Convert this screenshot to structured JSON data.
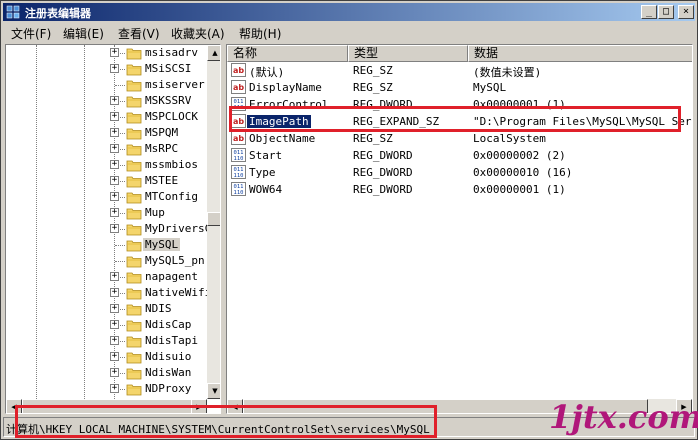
{
  "window": {
    "title": "注册表编辑器",
    "minimize_label": "_",
    "maximize_label": "□",
    "close_label": "×"
  },
  "menu": [
    {
      "label": "文件(F)"
    },
    {
      "label": "编辑(E)"
    },
    {
      "label": "查看(V)"
    },
    {
      "label": "收藏夹(A)"
    },
    {
      "label": "帮助(H)"
    }
  ],
  "tree": {
    "expander_symbol": "+",
    "items": [
      {
        "label": "msisadrv",
        "has_children": true
      },
      {
        "label": "MSiSCSI",
        "has_children": true
      },
      {
        "label": "msiserver",
        "has_children": false
      },
      {
        "label": "MSKSSRV",
        "has_children": true
      },
      {
        "label": "MSPCLOCK",
        "has_children": true
      },
      {
        "label": "MSPQM",
        "has_children": true
      },
      {
        "label": "MsRPC",
        "has_children": true
      },
      {
        "label": "mssmbios",
        "has_children": true
      },
      {
        "label": "MSTEE",
        "has_children": true
      },
      {
        "label": "MTConfig",
        "has_children": true
      },
      {
        "label": "Mup",
        "has_children": true
      },
      {
        "label": "MyDriversC",
        "has_children": true
      },
      {
        "label": "MySQL",
        "has_children": false,
        "selected": true
      },
      {
        "label": "MySQL5_pn",
        "has_children": false
      },
      {
        "label": "napagent",
        "has_children": true
      },
      {
        "label": "NativeWifi",
        "has_children": true
      },
      {
        "label": "NDIS",
        "has_children": true
      },
      {
        "label": "NdisCap",
        "has_children": true
      },
      {
        "label": "NdisTapi",
        "has_children": true
      },
      {
        "label": "Ndisuio",
        "has_children": true
      },
      {
        "label": "NdisWan",
        "has_children": true
      },
      {
        "label": "NDProxy",
        "has_children": true
      }
    ]
  },
  "list": {
    "columns": {
      "name": "名称",
      "type": "类型",
      "data": "数据"
    },
    "rows": [
      {
        "icon": "string-value-icon",
        "name": "(默认)",
        "type": "REG_SZ",
        "data": "(数值未设置)"
      },
      {
        "icon": "string-value-icon",
        "name": "DisplayName",
        "type": "REG_SZ",
        "data": "MySQL"
      },
      {
        "icon": "binary-value-icon",
        "name": "ErrorControl",
        "type": "REG_DWORD",
        "data": "0x00000001 (1)"
      },
      {
        "icon": "string-value-icon",
        "name": "ImagePath",
        "type": "REG_EXPAND_SZ",
        "data": "\"D:\\Program Files\\MySQL\\MySQL Server",
        "selected": true
      },
      {
        "icon": "string-value-icon",
        "name": "ObjectName",
        "type": "REG_SZ",
        "data": "LocalSystem"
      },
      {
        "icon": "binary-value-icon",
        "name": "Start",
        "type": "REG_DWORD",
        "data": "0x00000002 (2)"
      },
      {
        "icon": "binary-value-icon",
        "name": "Type",
        "type": "REG_DWORD",
        "data": "0x00000010 (16)"
      },
      {
        "icon": "binary-value-icon",
        "name": "WOW64",
        "type": "REG_DWORD",
        "data": "0x00000001 (1)"
      }
    ]
  },
  "statusbar": {
    "path": "计算机\\HKEY_LOCAL_MACHINE\\SYSTEM\\CurrentControlSet\\services\\MySQL"
  },
  "watermark": "1jtx.com",
  "colors": {
    "title_gradient_start": "#0a246a",
    "title_gradient_end": "#a6caf0",
    "selection": "#0a246a",
    "annotation_red": "#e0202a",
    "watermark": "#b0177a"
  }
}
